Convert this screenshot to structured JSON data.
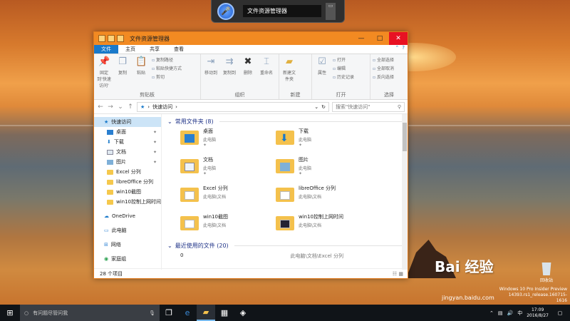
{
  "cortana": {
    "text": "文件资源管理器"
  },
  "window": {
    "title": "文件资源管理器",
    "tabs": [
      "文件",
      "主页",
      "共享",
      "查看"
    ],
    "ribbon": {
      "groups": [
        {
          "label": "剪贴板",
          "buttons": [
            "固定到'快速访问'",
            "复制",
            "粘贴"
          ],
          "small": [
            "复制路径",
            "粘贴快捷方式",
            "剪切"
          ]
        },
        {
          "label": "组织",
          "buttons": [
            "移动到",
            "复制到",
            "删除",
            "重命名"
          ]
        },
        {
          "label": "新建",
          "buttons": [
            "新建文件夹"
          ],
          "small": []
        },
        {
          "label": "打开",
          "buttons": [
            "属性"
          ],
          "small": [
            "打开",
            "编辑",
            "历史记录"
          ]
        },
        {
          "label": "选择",
          "small": [
            "全部选择",
            "全部取消",
            "反向选择"
          ]
        }
      ]
    },
    "address": {
      "path": "快速访问",
      "search_placeholder": "搜索\"快速访问\""
    },
    "nav_pane": {
      "quick_access": "快速访问",
      "pinned": [
        "桌面",
        "下载",
        "文档",
        "图片"
      ],
      "folders": [
        "Excel 分列",
        "libreOffice 分列",
        "win10截图",
        "win10控制上网时间"
      ],
      "onedrive": "OneDrive",
      "this_pc": "此电脑",
      "network": "网络",
      "homegroup": "家庭组"
    },
    "frequent": {
      "header": "常用文件夹 (8)",
      "items": [
        {
          "name": "桌面",
          "loc": "此电脑"
        },
        {
          "name": "下载",
          "loc": "此电脑"
        },
        {
          "name": "文档",
          "loc": "此电脑"
        },
        {
          "name": "图片",
          "loc": "此电脑"
        },
        {
          "name": "Excel 分列",
          "loc": "此电脑\\文档"
        },
        {
          "name": "libreOffice 分列",
          "loc": "此电脑\\文档"
        },
        {
          "name": "win10截图",
          "loc": "此电脑\\文档"
        },
        {
          "name": "win10控制上网时间",
          "loc": "此电脑\\文档"
        }
      ]
    },
    "recent": {
      "header": "最近使用的文件 (20)",
      "first_name": "0",
      "first_path": "此电脑\\文档\\Excel 分列"
    },
    "status": "28 个项目"
  },
  "taskbar": {
    "search_placeholder": "有问题尽管问我",
    "time": "17:09",
    "date": "2016/8/27"
  },
  "desktop": {
    "recycle": "回收站",
    "watermark": "Bai 经验",
    "watermark_url": "jingyan.baidu.com",
    "win_version": "Windows 10 Pro Insider Preview\n14393.rs1_release.160715-1616"
  }
}
